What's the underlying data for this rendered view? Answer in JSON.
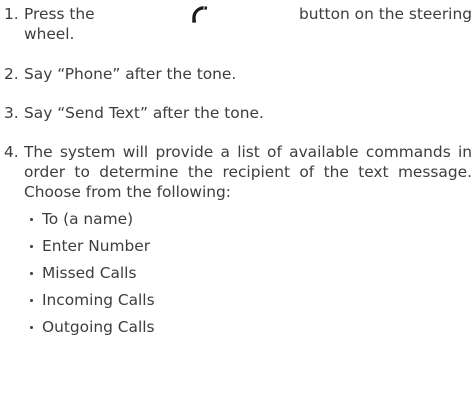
{
  "steps": [
    {
      "number": "1.",
      "text_before_icon": "Press the",
      "icon": "phone-handset-icon",
      "text_after_icon": "button on the steering",
      "text_line2": "wheel."
    },
    {
      "number": "2.",
      "text": "Say “Phone” after the tone."
    },
    {
      "number": "3.",
      "text": "Say “Send Text” after the tone."
    },
    {
      "number": "4.",
      "text": "The system will provide a list of available commands in order to determine the recipient of the text message. Choose from the following:",
      "options": [
        "To (a name)",
        "Enter Number",
        "Missed Calls",
        "Incoming Calls",
        "Outgoing Calls"
      ]
    }
  ]
}
